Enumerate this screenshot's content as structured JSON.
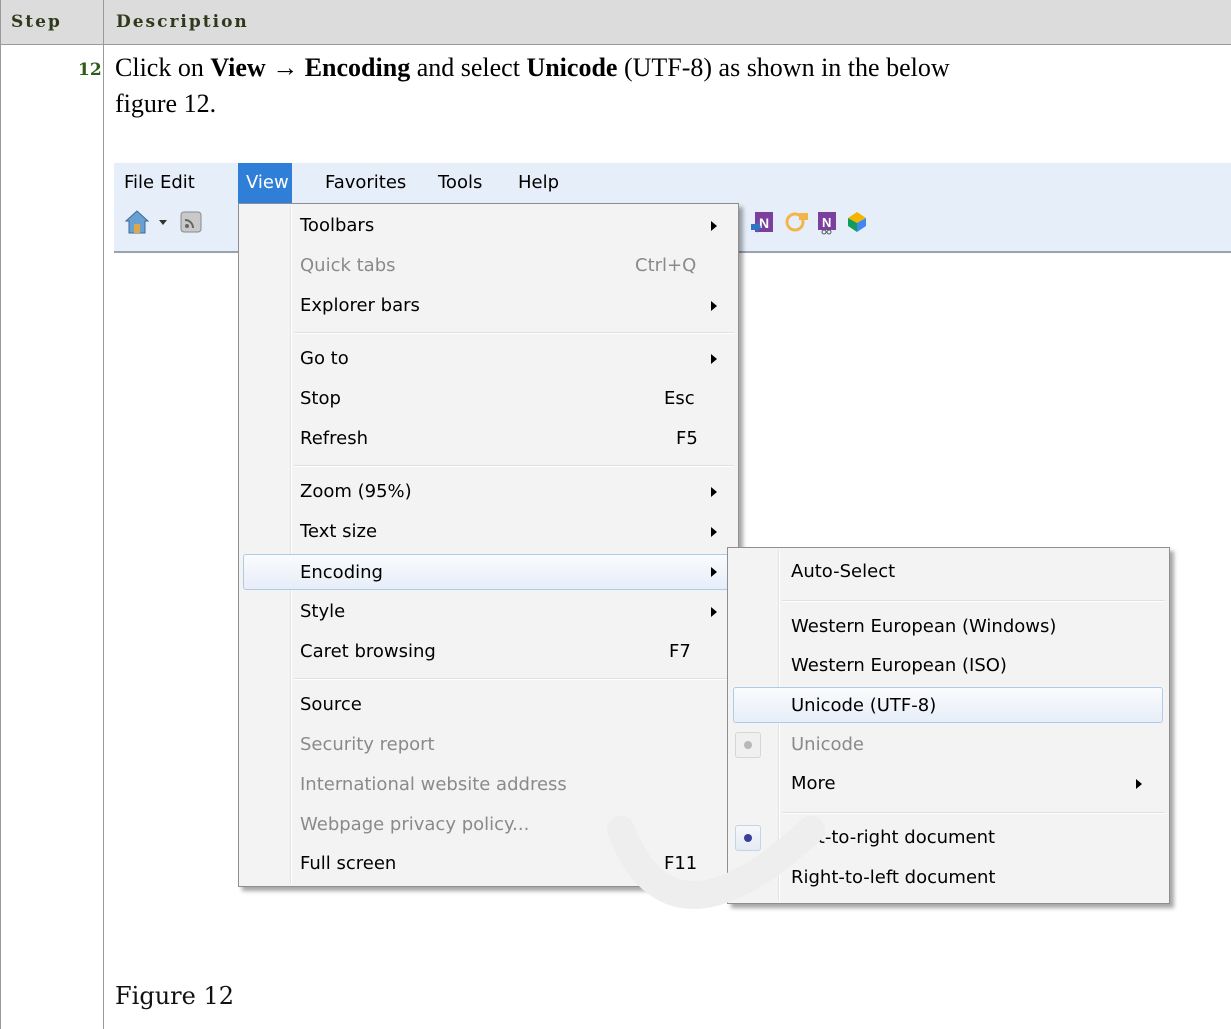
{
  "header": {
    "step": "Step",
    "description": "Description"
  },
  "row": {
    "step_number": "12",
    "instruction": {
      "t1": "Click on ",
      "b1": "View",
      "arrow": " → ",
      "b2": "Encoding",
      "t2": " and select ",
      "b3": "Unicode",
      "t3": " (UTF-8) as shown in the below figure 12."
    },
    "caption": "Figure 12"
  },
  "screenshot": {
    "menubar": [
      "File",
      "Edit",
      "View",
      "Favorites",
      "Tools",
      "Help"
    ],
    "active_menu": "View",
    "toolbar_icons": [
      "home-icon",
      "dropdown-arrow-icon",
      "rss-feed-icon",
      "onenote-send-icon",
      "ie-addon-icon",
      "onenote-linked-icon",
      "colorful-addon-icon"
    ],
    "view_menu": [
      {
        "label": "Toolbars",
        "shortcut": "",
        "submenu": true,
        "disabled": false
      },
      {
        "label": "Quick tabs",
        "shortcut": "Ctrl+Q",
        "submenu": false,
        "disabled": true
      },
      {
        "label": "Explorer bars",
        "shortcut": "",
        "submenu": true,
        "disabled": false
      },
      {
        "label": "Go to",
        "shortcut": "",
        "submenu": true,
        "disabled": false
      },
      {
        "label": "Stop",
        "shortcut": "Esc",
        "submenu": false,
        "disabled": false
      },
      {
        "label": "Refresh",
        "shortcut": "F5",
        "submenu": false,
        "disabled": false
      },
      {
        "label": "Zoom (95%)",
        "shortcut": "",
        "submenu": true,
        "disabled": false
      },
      {
        "label": "Text size",
        "shortcut": "",
        "submenu": true,
        "disabled": false
      },
      {
        "label": "Encoding",
        "shortcut": "",
        "submenu": true,
        "disabled": false,
        "highlighted": true
      },
      {
        "label": "Style",
        "shortcut": "",
        "submenu": true,
        "disabled": false
      },
      {
        "label": "Caret browsing",
        "shortcut": "F7",
        "submenu": false,
        "disabled": false
      },
      {
        "label": "Source",
        "shortcut": "",
        "submenu": false,
        "disabled": false
      },
      {
        "label": "Security report",
        "shortcut": "",
        "submenu": false,
        "disabled": true
      },
      {
        "label": "International website address",
        "shortcut": "",
        "submenu": false,
        "disabled": true
      },
      {
        "label": "Webpage privacy policy...",
        "shortcut": "",
        "submenu": false,
        "disabled": true
      },
      {
        "label": "Full screen",
        "shortcut": "F11",
        "submenu": false,
        "disabled": false
      }
    ],
    "encoding_menu": [
      {
        "label": "Auto-Select",
        "disabled": false
      },
      {
        "label": "Western European (Windows)",
        "disabled": false
      },
      {
        "label": "Western European (ISO)",
        "disabled": false
      },
      {
        "label": "Unicode (UTF-8)",
        "disabled": false,
        "highlighted": true
      },
      {
        "label": "Unicode",
        "disabled": true,
        "radio": "grey"
      },
      {
        "label": "More",
        "disabled": false,
        "submenu": true
      },
      {
        "label": "Left-to-right document",
        "disabled": false,
        "radio": "selected"
      },
      {
        "label": "Right-to-left document",
        "disabled": false
      }
    ],
    "colors": {
      "highlight_border": "#aecbe9",
      "menubar_bg": "#e6eff9",
      "active_menu_bg": "#2f7ed8",
      "radio_dot": "#3b3f9a"
    }
  }
}
